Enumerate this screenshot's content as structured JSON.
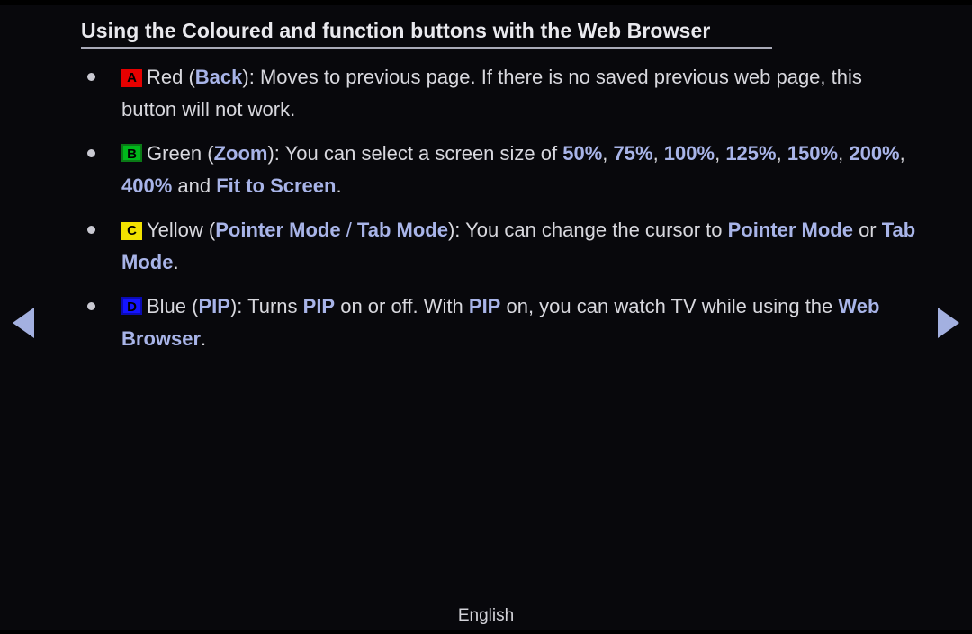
{
  "screen": {
    "background_color": "#08080c",
    "highlight_color": "#a8b4e8",
    "text_color": "#d8d8de"
  },
  "header": {
    "title": "Using the Coloured and function buttons with the Web Browser"
  },
  "bullets": [
    {
      "badge": {
        "letter": "A",
        "color_name": "red",
        "color": "#e60000"
      },
      "segments": [
        {
          "text": "Red (",
          "style": "plain"
        },
        {
          "text": "Back",
          "style": "highlight"
        },
        {
          "text": "): Moves to previous page. If there is no saved previous web page, this button will not work.",
          "style": "plain"
        }
      ]
    },
    {
      "badge": {
        "letter": "B",
        "color_name": "green",
        "color": "#00b81b"
      },
      "segments": [
        {
          "text": "Green (",
          "style": "plain"
        },
        {
          "text": "Zoom",
          "style": "highlight"
        },
        {
          "text": "): You can select a screen size of ",
          "style": "plain"
        },
        {
          "text": "50%",
          "style": "highlight"
        },
        {
          "text": ", ",
          "style": "plain"
        },
        {
          "text": "75%",
          "style": "highlight"
        },
        {
          "text": ", ",
          "style": "plain"
        },
        {
          "text": "100%",
          "style": "highlight"
        },
        {
          "text": ", ",
          "style": "plain"
        },
        {
          "text": "125%",
          "style": "highlight"
        },
        {
          "text": ", ",
          "style": "plain"
        },
        {
          "text": "150%",
          "style": "highlight"
        },
        {
          "text": ", ",
          "style": "plain"
        },
        {
          "text": "200%",
          "style": "highlight"
        },
        {
          "text": ", ",
          "style": "plain"
        },
        {
          "text": "400%",
          "style": "highlight"
        },
        {
          "text": " and ",
          "style": "plain"
        },
        {
          "text": "Fit to Screen",
          "style": "highlight"
        },
        {
          "text": ".",
          "style": "plain"
        }
      ]
    },
    {
      "badge": {
        "letter": "C",
        "color_name": "yellow",
        "color": "#f2e200"
      },
      "segments": [
        {
          "text": "Yellow (",
          "style": "plain"
        },
        {
          "text": "Pointer Mode",
          "style": "highlight"
        },
        {
          "text": " / ",
          "style": "highlight-normal"
        },
        {
          "text": "Tab Mode",
          "style": "highlight"
        },
        {
          "text": "): You can change the cursor to ",
          "style": "plain"
        },
        {
          "text": "Pointer Mode",
          "style": "highlight"
        },
        {
          "text": " or ",
          "style": "plain"
        },
        {
          "text": "Tab Mode",
          "style": "highlight"
        },
        {
          "text": ".",
          "style": "plain"
        }
      ]
    },
    {
      "badge": {
        "letter": "D",
        "color_name": "blue",
        "color": "#1414ff"
      },
      "segments": [
        {
          "text": "Blue (",
          "style": "plain"
        },
        {
          "text": "PIP",
          "style": "highlight"
        },
        {
          "text": "): Turns ",
          "style": "plain"
        },
        {
          "text": "PIP",
          "style": "highlight"
        },
        {
          "text": " on or off. With ",
          "style": "plain"
        },
        {
          "text": "PIP",
          "style": "highlight"
        },
        {
          "text": " on, you can watch TV while using the ",
          "style": "plain"
        },
        {
          "text": "Web Browser",
          "style": "highlight"
        },
        {
          "text": ".",
          "style": "plain"
        }
      ]
    }
  ],
  "navigation": {
    "previous_label": "◀",
    "next_label": "▶"
  },
  "footer": {
    "language": "English"
  }
}
